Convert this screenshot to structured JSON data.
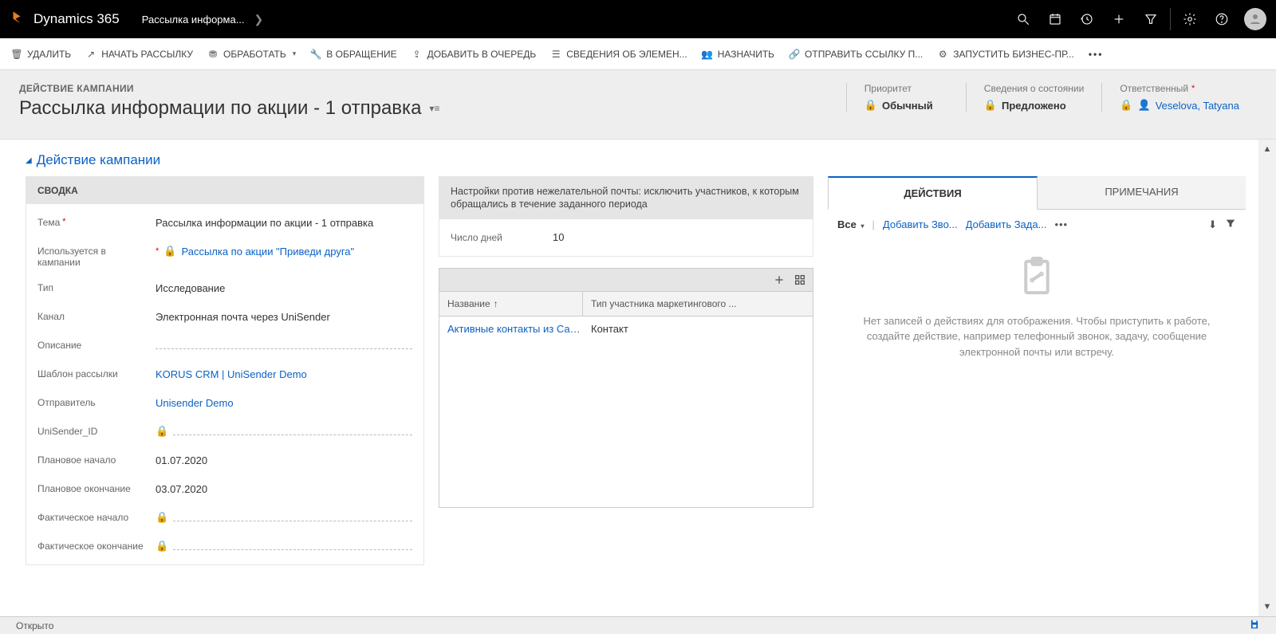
{
  "nav": {
    "brand": "Dynamics 365",
    "breadcrumb": "Рассылка информа..."
  },
  "commands": {
    "delete": "УДАЛИТЬ",
    "start": "НАЧАТЬ РАССЫЛКУ",
    "process": "ОБРАБОТАТЬ",
    "toCase": "В ОБРАЩЕНИЕ",
    "addQueue": "ДОБАВИТЬ В ОЧЕРЕДЬ",
    "itemInfo": "СВЕДЕНИЯ ОБ ЭЛЕМЕН...",
    "assign": "НАЗНАЧИТЬ",
    "sendLink": "ОТПРАВИТЬ ССЫЛКУ П...",
    "runBp": "ЗАПУСТИТЬ БИЗНЕС-ПР..."
  },
  "header": {
    "eyebrow": "ДЕЙСТВИЕ КАМПАНИИ",
    "title": "Рассылка информации по акции - 1 отправка",
    "priorityLabel": "Приоритет",
    "priorityValue": "Обычный",
    "statusLabel": "Сведения о состоянии",
    "statusValue": "Предложено",
    "ownerLabel": "Ответственный",
    "ownerValue": "Veselova, Tatyana"
  },
  "sectionTitle": "Действие кампании",
  "summary": {
    "head": "СВОДКА",
    "subjectLabel": "Тема",
    "subjectValue": "Рассылка информации по акции - 1 отправка",
    "campaignLabel": "Используется в кампании",
    "campaignValue": "Рассылка по акции \"Приведи друга\"",
    "typeLabel": "Тип",
    "typeValue": "Исследование",
    "channelLabel": "Канал",
    "channelValue": "Электронная почта через UniSender",
    "descLabel": "Описание",
    "templateLabel": "Шаблон рассылки",
    "templateValue": "KORUS CRM | UniSender Demo",
    "senderLabel": "Отправитель",
    "senderValue": "Unisender Demo",
    "unisenderIdLabel": "UniSender_ID",
    "plannedStartLabel": "Плановое начало",
    "plannedStartValue": "01.07.2020",
    "plannedEndLabel": "Плановое окончание",
    "plannedEndValue": "03.07.2020",
    "actualStartLabel": "Фактическое начало",
    "actualEndLabel": "Фактическое окончание"
  },
  "antispam": {
    "head": "Настройки против нежелательной почты: исключить участников, к которым обращались в течение заданного периода",
    "daysLabel": "Число дней",
    "daysValue": "10"
  },
  "subgrid": {
    "col1": "Название",
    "col2": "Тип участника маркетингового ...",
    "row1name": "Активные контакты из Санк...",
    "row1type": "Контакт"
  },
  "tabs": {
    "activities": "ДЕЙСТВИЯ",
    "notes": "ПРИМЕЧАНИЯ"
  },
  "activities": {
    "all": "Все",
    "addCall": "Добавить Зво...",
    "addTask": "Добавить Зада...",
    "emptyText": "Нет записей о действиях для отображения. Чтобы приступить к работе, создайте действие, например телефонный звонок, задачу, сообщение электронной почты или встречу."
  },
  "statusBar": {
    "status": "Открыто"
  }
}
